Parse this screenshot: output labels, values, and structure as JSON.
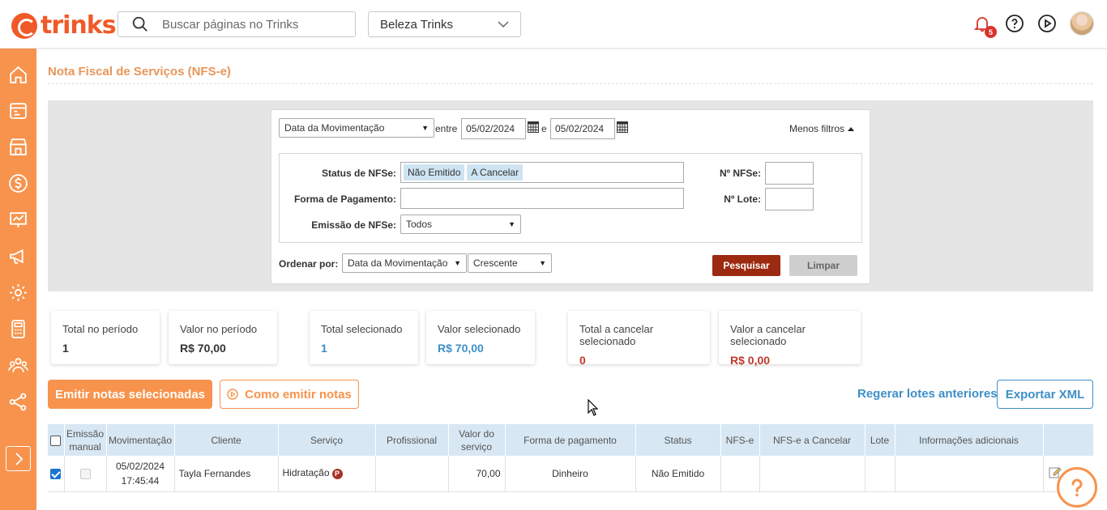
{
  "header": {
    "logo_text": "trinks",
    "search_placeholder": "Buscar páginas no Trinks",
    "salon_name": "Beleza Trinks",
    "notification_count": "5"
  },
  "page": {
    "title": "Nota Fiscal de Serviços (NFS-e)"
  },
  "filters": {
    "date_type": "Data da Movimentação",
    "between_label": "entre",
    "date_from": "05/02/2024",
    "and_label": "e",
    "date_to": "05/02/2024",
    "less_filters": "Menos filtros",
    "status_label": "Status de NFSe:",
    "status_tags": [
      "Não Emitido",
      "A Cancelar"
    ],
    "payment_label": "Forma de Pagamento:",
    "payment_value": "",
    "emission_label": "Emissão de NFSe:",
    "emission_value": "Todos",
    "nfse_number_label": "Nº NFSe:",
    "lote_label": "Nº Lote:",
    "order_label": "Ordenar por:",
    "order_field": "Data da Movimentação",
    "order_dir": "Crescente",
    "search_button": "Pesquisar",
    "clear_button": "Limpar"
  },
  "cards": [
    {
      "label": "Total no período",
      "value": "1"
    },
    {
      "label": "Valor no período",
      "value": "R$ 70,00"
    },
    {
      "label": "Total selecionado",
      "value": "1"
    },
    {
      "label": "Valor selecionado",
      "value": "R$ 70,00"
    },
    {
      "label": "Total a cancelar selecionado",
      "value": "0"
    },
    {
      "label": "Valor a cancelar selecionado",
      "value": "R$ 0,00"
    }
  ],
  "actions": {
    "emit_selected": "Emitir notas selecionadas",
    "how_to_emit": "Como emitir notas",
    "regenerate": "Regerar lotes anteriores",
    "export_xml": "Exportar XML"
  },
  "table": {
    "headers": [
      "Emissão manual",
      "Movimentação",
      "Cliente",
      "Serviço",
      "Profissional",
      "Valor do serviço",
      "Forma de pagamento",
      "Status",
      "NFS-e",
      "NFS-e a Cancelar",
      "Lote",
      "Informações adicionais"
    ],
    "rows": [
      {
        "selected": true,
        "date": "05/02/2024",
        "time": "17:45:44",
        "cliente": "Tayla Fernandes",
        "servico": "Hidratação",
        "servico_badge": "P",
        "profissional": "",
        "valor": "70,00",
        "forma": "Dinheiro",
        "status": "Não Emitido",
        "nfse": "",
        "nfse_cancelar": "",
        "lote": "",
        "info": ""
      }
    ]
  },
  "colors": {
    "brand_orange": "#f7934c",
    "logo_orange": "#f05a28",
    "primary_blue": "#3e8fc6",
    "search_button": "#9c2a10"
  }
}
